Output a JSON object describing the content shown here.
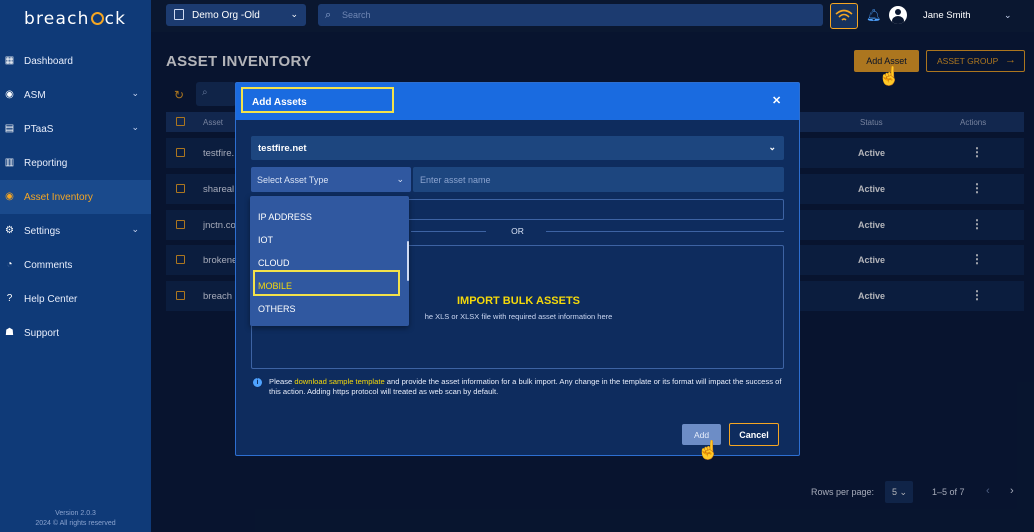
{
  "brand": {
    "logo_left": "breach",
    "logo_right": "ck"
  },
  "sidebar": {
    "items": [
      {
        "label": "Dashboard",
        "icon": "dashboard-icon",
        "glyph": "▦",
        "has_children": false,
        "active": false
      },
      {
        "label": "ASM",
        "icon": "target-icon",
        "glyph": "◉",
        "has_children": true,
        "active": false
      },
      {
        "label": "PTaaS",
        "icon": "ptaas-icon",
        "glyph": "▤",
        "has_children": true,
        "active": false
      },
      {
        "label": "Reporting",
        "icon": "report-icon",
        "glyph": "▥",
        "has_children": false,
        "active": false
      },
      {
        "label": "Asset Inventory",
        "icon": "asset-inventory-icon",
        "glyph": "◉",
        "has_children": false,
        "active": true
      },
      {
        "label": "Settings",
        "icon": "gear-icon",
        "glyph": "⚙",
        "has_children": true,
        "active": false
      },
      {
        "label": "Comments",
        "icon": "comment-icon",
        "glyph": "◔",
        "has_children": false,
        "active": false
      },
      {
        "label": "Help Center",
        "icon": "help-icon",
        "glyph": "?",
        "has_children": false,
        "active": false
      },
      {
        "label": "Support",
        "icon": "support-icon",
        "glyph": "☗",
        "has_children": false,
        "active": false
      }
    ],
    "version": "Version 2.0.3",
    "copyright": "2024 © All rights reserved"
  },
  "topbar": {
    "org": "Demo Org -Old",
    "search_placeholder": "Search",
    "user_name": "Jane Smith"
  },
  "page": {
    "title": "ASSET INVENTORY",
    "add_asset_button": "Add Asset",
    "asset_group_button": "ASSET GROUP"
  },
  "table": {
    "columns": {
      "asset": "Asset",
      "status": "Status",
      "actions": "Actions"
    },
    "rows": [
      {
        "asset": "testfire.",
        "status": "Active"
      },
      {
        "asset": "shareal",
        "status": "Active"
      },
      {
        "asset": "jnctn.co",
        "status": "Active"
      },
      {
        "asset": "brokene",
        "status": "Active"
      },
      {
        "asset": "breach",
        "status": "Active"
      }
    ]
  },
  "pagination": {
    "rows_per_page_label": "Rows per page:",
    "rows_per_page": "5",
    "range": "1–5 of 7"
  },
  "modal": {
    "title": "Add Assets",
    "domain_value": "testfire.net",
    "asset_type_placeholder": "Select Asset Type",
    "asset_name_placeholder": "Enter asset name",
    "or": "OR",
    "bulk_title": "IMPORT BULK ASSETS",
    "bulk_subtitle": "he XLS or XLSX file with required asset information here",
    "note_prefix": "Please ",
    "note_link": "download sample template",
    "note_suffix": " and provide the asset information for a bulk import. Any change in the template or its format will impact the success of this action. Adding https protocol will treated as web scan by default.",
    "add_button": "Add",
    "cancel_button": "Cancel"
  },
  "asset_type_options": [
    "IP ADDRESS",
    "IOT",
    "CLOUD",
    "MOBILE",
    "OTHERS"
  ],
  "colors": {
    "accent": "#f5a623",
    "highlight": "#f3e24a",
    "modal_header": "#1a6be0",
    "sidebar": "#0f3a78"
  }
}
